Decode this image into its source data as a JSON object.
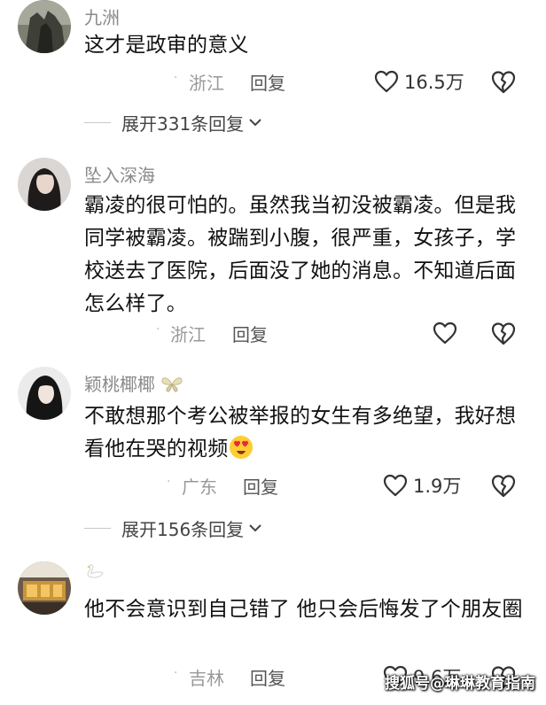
{
  "comments": [
    {
      "username": "九洲",
      "text": "这才是政审的意义",
      "location": "浙江",
      "reply_label": "回复",
      "likes": "16.5万",
      "expand": "展开331条回复"
    },
    {
      "username": "坠入深海",
      "text": "霸凌的很可怕的。虽然我当初没被霸凌。但是我同学被霸凌。被踹到小腹，很严重，女孩子，学校送去了医院，后面没了她的消息。不知道后面怎么样了。",
      "location": "浙江",
      "reply_label": "回复",
      "likes": ""
    },
    {
      "username": "颖桃椰椰",
      "text": "不敢想那个考公被举报的女生有多绝望，我好想看他在哭的视频",
      "location": "广东",
      "reply_label": "回复",
      "likes": "1.9万",
      "expand": "展开156条回复"
    },
    {
      "username": "",
      "text": "他不会意识到自己错了 他只会后悔发了个朋友圈",
      "location": "吉林",
      "reply_label": "回复",
      "likes": "9.6万"
    }
  ],
  "watermark": "搜狐号@琳琳教育指南",
  "icons": {
    "like": "heart-outline-icon",
    "dislike": "broken-heart-icon",
    "expand": "chevron-down-icon",
    "emoji": "heart-eyes-emoji-icon",
    "name_decoration": "butterfly-icon",
    "name_badge": "swan-icon"
  },
  "colors": {
    "username": "#8a8a8a",
    "text": "#111111",
    "meta": "#999999",
    "icon_stroke": "#333333"
  }
}
